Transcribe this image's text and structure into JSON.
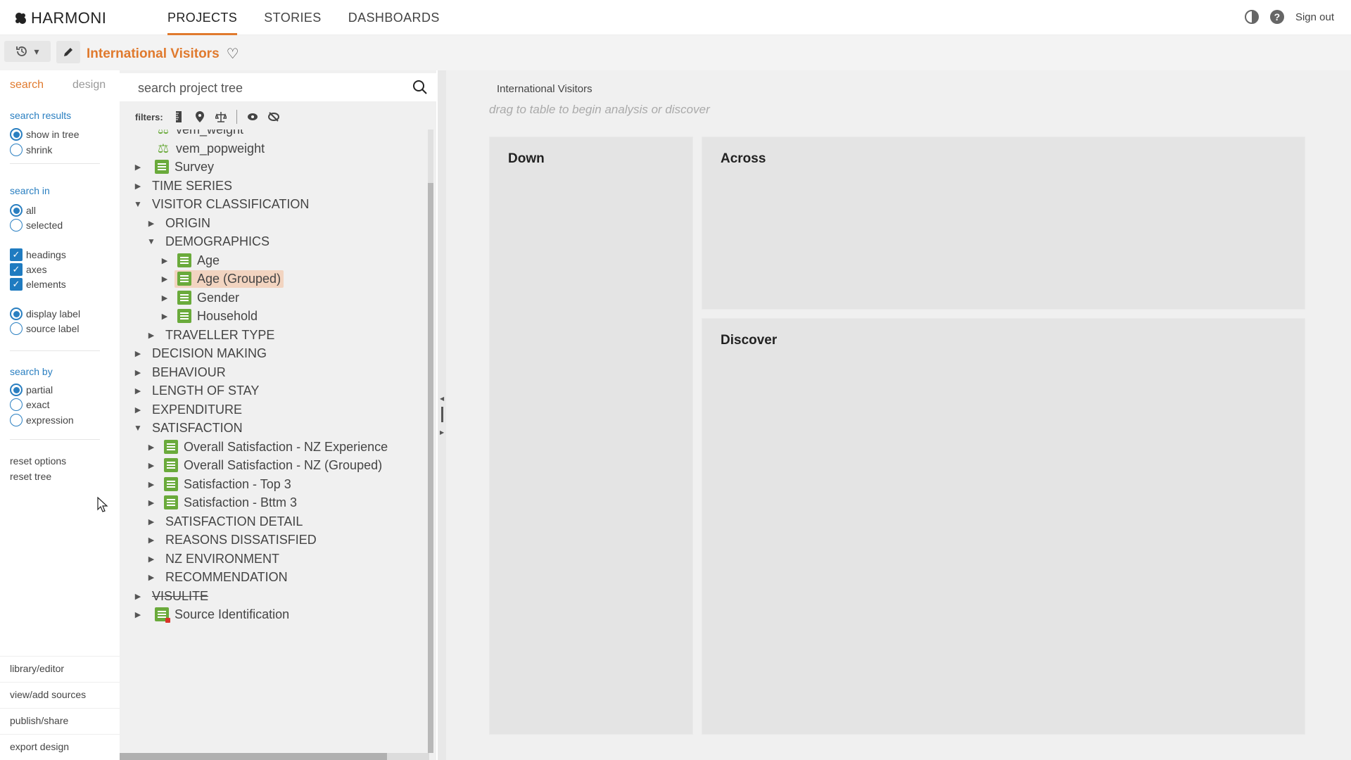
{
  "app": {
    "name": "HARMONI"
  },
  "nav": {
    "projects": "PROJECTS",
    "stories": "STORIES",
    "dashboards": "DASHBOARDS"
  },
  "header": {
    "signout": "Sign out"
  },
  "project": {
    "title": "International Visitors"
  },
  "options": {
    "tabs": {
      "search": "search",
      "design": "design"
    },
    "search_results": {
      "heading": "search results",
      "show_in_tree": "show in tree",
      "shrink": "shrink"
    },
    "search_in": {
      "heading": "search in",
      "all": "all",
      "selected": "selected",
      "headings": "headings",
      "axes": "axes",
      "elements": "elements",
      "display_label": "display label",
      "source_label": "source label"
    },
    "search_by": {
      "heading": "search by",
      "partial": "partial",
      "exact": "exact",
      "expression": "expression"
    },
    "reset_options": "reset options",
    "reset_tree": "reset tree",
    "bottom": {
      "library": "library/editor",
      "sources": "view/add sources",
      "publish": "publish/share",
      "export": "export design"
    }
  },
  "tree_panel": {
    "search_placeholder": "search project tree",
    "filters_label": "filters:"
  },
  "tree": [
    {
      "label": "vem_weight",
      "icon": "scale-icon"
    },
    {
      "label": "vem_popweight",
      "icon": "scale-icon"
    },
    {
      "label": "Survey",
      "icon": "doc-icon"
    },
    {
      "label": "TIME SERIES"
    },
    {
      "label": "VISITOR CLASSIFICATION",
      "expanded": true
    },
    {
      "label": "ORIGIN"
    },
    {
      "label": "DEMOGRAPHICS",
      "expanded": true
    },
    {
      "label": "Age",
      "icon": "doc-icon"
    },
    {
      "label": "Age (Grouped)",
      "icon": "doc-icon",
      "selected": true
    },
    {
      "label": "Gender",
      "icon": "doc-icon"
    },
    {
      "label": "Household",
      "icon": "doc-icon"
    },
    {
      "label": "TRAVELLER TYPE"
    },
    {
      "label": "DECISION MAKING"
    },
    {
      "label": "BEHAVIOUR"
    },
    {
      "label": "LENGTH OF STAY"
    },
    {
      "label": "EXPENDITURE"
    },
    {
      "label": "SATISFACTION",
      "expanded": true
    },
    {
      "label": "Overall Satisfaction - NZ Experience",
      "icon": "doc-icon"
    },
    {
      "label": "Overall Satisfaction - NZ (Grouped)",
      "icon": "doc-icon"
    },
    {
      "label": "Satisfaction - Top 3",
      "icon": "doc-icon"
    },
    {
      "label": "Satisfaction - Bttm 3",
      "icon": "doc-icon"
    },
    {
      "label": "SATISFACTION DETAIL"
    },
    {
      "label": "REASONS DISSATISFIED"
    },
    {
      "label": "NZ ENVIRONMENT"
    },
    {
      "label": "RECOMMENDATION"
    },
    {
      "label": "VISULITE",
      "struck": true
    },
    {
      "label": "Source Identification",
      "icon": "doc-icon-red"
    }
  ],
  "main": {
    "title": "International Visitors",
    "hint": "drag to table to begin analysis or discover",
    "down": "Down",
    "across": "Across",
    "discover": "Discover"
  },
  "colors": {
    "accent": "#e07a2e",
    "link": "#2a7fc1",
    "doc_green": "#6aaa3b"
  }
}
